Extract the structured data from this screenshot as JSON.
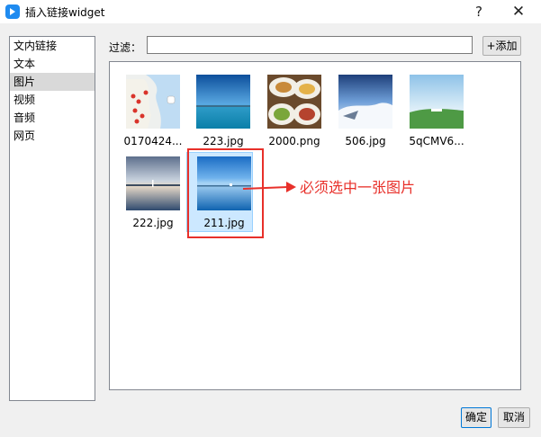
{
  "window": {
    "title": "插入链接widget",
    "help": "?",
    "close": "✕"
  },
  "sidebar": {
    "items": [
      {
        "label": "文内链接",
        "active": false
      },
      {
        "label": "文本",
        "active": false
      },
      {
        "label": "图片",
        "active": true
      },
      {
        "label": "视频",
        "active": false
      },
      {
        "label": "音频",
        "active": false
      },
      {
        "label": "网页",
        "active": false
      }
    ]
  },
  "filter": {
    "label": "过滤：",
    "value": "",
    "add_label": "+添加"
  },
  "gallery": {
    "items": [
      {
        "name": "0170424...",
        "icon": "map-thumbnail"
      },
      {
        "name": "223.jpg",
        "icon": "sea-thumbnail"
      },
      {
        "name": "2000.png",
        "icon": "food-thumbnail"
      },
      {
        "name": "506.jpg",
        "icon": "sky-thumbnail"
      },
      {
        "name": "5qCMV6...",
        "icon": "landscape-thumbnail"
      },
      {
        "name": "222.jpg",
        "icon": "sunset-thumbnail"
      },
      {
        "name": "211.jpg",
        "icon": "ocean-thumbnail",
        "selected": true
      }
    ]
  },
  "annotation": {
    "text": "必须选中一张图片",
    "color": "#e8302a"
  },
  "footer": {
    "ok_label": "确定",
    "cancel_label": "取消"
  }
}
